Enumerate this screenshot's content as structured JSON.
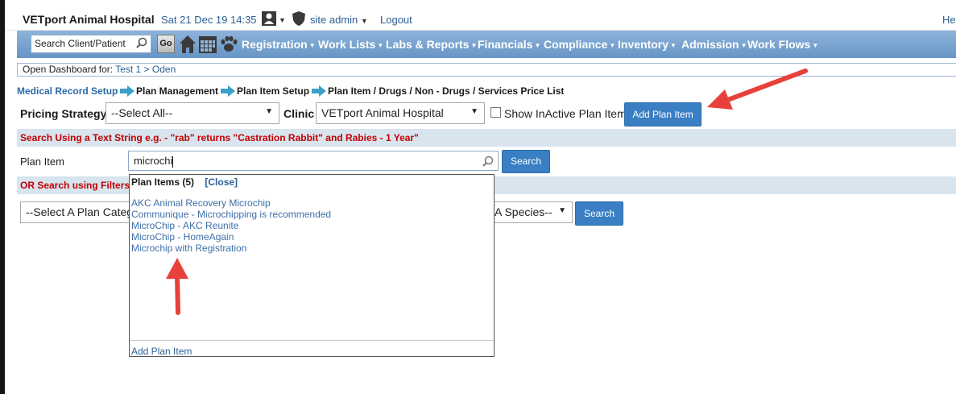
{
  "header": {
    "hospital_name": "VETport Animal Hospital",
    "datetime": "Sat 21 Dec 19 14:35",
    "user": "site admin",
    "logout": "Logout",
    "help": "He"
  },
  "nav": {
    "search_placeholder": "Search Client/Patient",
    "go_label": "Go",
    "menus": [
      "Registration",
      "Work Lists",
      "Labs & Reports",
      "Financials",
      "Compliance",
      "Inventory",
      "Admission",
      "Work Flows"
    ]
  },
  "dashboard": {
    "prefix": "Open Dashboard for:",
    "patient": "Test 1 > Oden"
  },
  "breadcrumb": {
    "items": [
      "Medical Record Setup",
      "Plan Management",
      "Plan Item Setup",
      "Plan Item / Drugs / Non - Drugs / Services Price List"
    ]
  },
  "filters": {
    "pricing_label": "Pricing Strategy",
    "pricing_value": "--Select All--",
    "clinic_label": "Clinic",
    "clinic_value": "VETport Animal Hospital",
    "show_inactive_label": "Show InActive Plan Item",
    "add_plan_item": "Add Plan Item"
  },
  "text_search": {
    "hint": "Search Using a Text String e.g. - \"rab\" returns \"Castration Rabbit\" and Rabies - 1 Year\"",
    "plan_item_label": "Plan Item",
    "plan_item_value": "microchi",
    "search_button": "Search"
  },
  "filter_search": {
    "title": "OR Search using Filters",
    "category_value": "--Select A Plan Categ",
    "species_value": "t A Species--",
    "search_button": "Search"
  },
  "autocomplete": {
    "header": "Plan Items (5)",
    "close_label": "[Close]",
    "items": [
      "AKC Animal Recovery Microchip",
      "Communique - Microchipping is recommended",
      "MicroChip - AKC Reunite",
      "MicroChip - HomeAgain",
      "Microchip with Registration"
    ],
    "add_plan_item": "Add Plan Item"
  },
  "colors": {
    "nav_blue": "#6f9bc9",
    "button_blue": "#3a7fc4",
    "hint_red": "#c00000",
    "annotation_red": "#e8403a",
    "link_blue": "#2a5f95"
  }
}
